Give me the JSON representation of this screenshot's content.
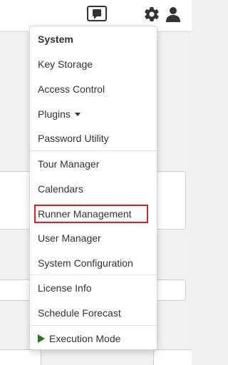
{
  "header": {
    "icons": {
      "chat": "chat-icon",
      "gear": "gear-icon",
      "user": "user-icon"
    }
  },
  "menu": {
    "title": "System",
    "items": {
      "key_storage": "Key Storage",
      "access_control": "Access Control",
      "plugins": "Plugins",
      "password_utility": "Password Utility",
      "tour_manager": "Tour Manager",
      "calendars": "Calendars",
      "runner_management": "Runner Management",
      "user_manager": "User Manager",
      "system_configuration": "System Configuration",
      "license_info": "License Info",
      "schedule_forecast": "Schedule Forecast",
      "execution_mode": "Execution Mode"
    }
  },
  "colors": {
    "highlight_border": "#e01f1f",
    "execution_play": "#1f7a1f",
    "menu_text": "#333333"
  }
}
